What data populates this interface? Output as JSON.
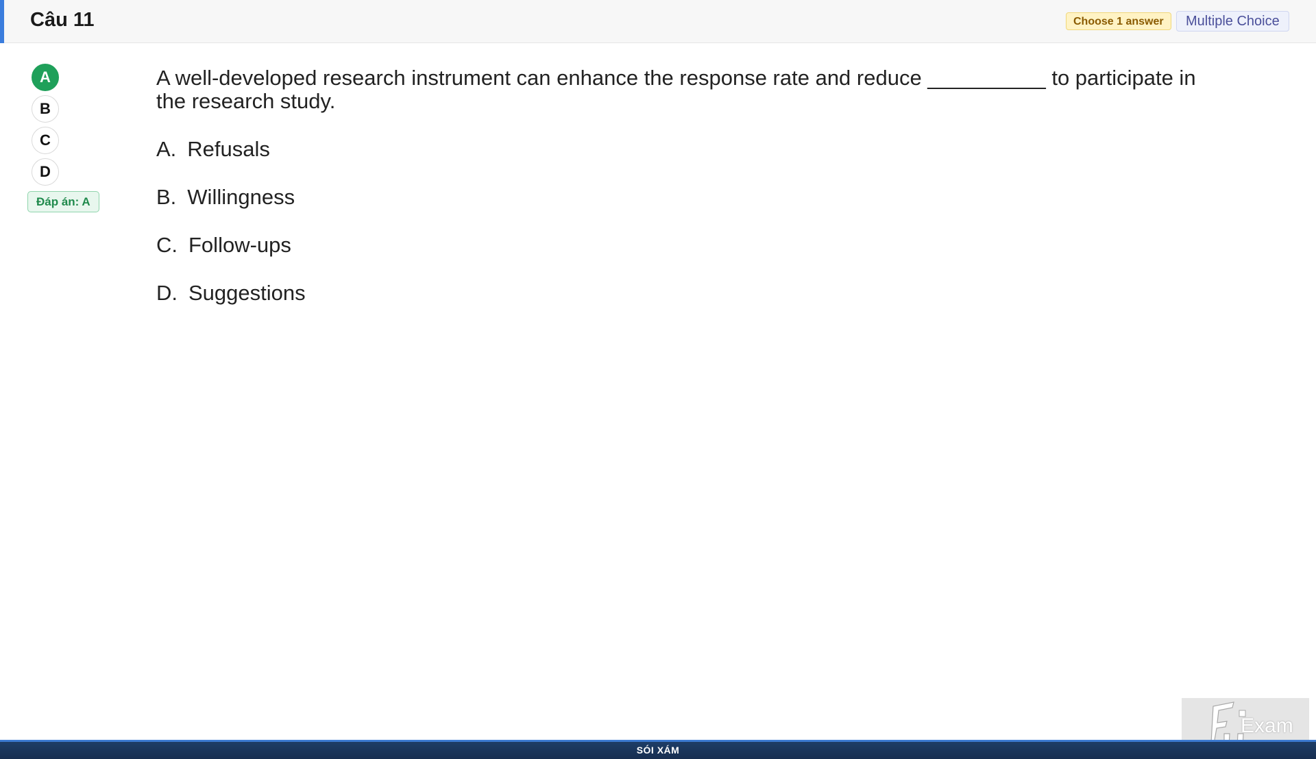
{
  "header": {
    "title": "Câu 11",
    "choose_badge": "Choose 1 answer",
    "type_badge": "Multiple Choice",
    "accent_color": "#3b7ddd"
  },
  "selector": {
    "options": [
      {
        "letter": "A",
        "selected": true
      },
      {
        "letter": "B",
        "selected": false
      },
      {
        "letter": "C",
        "selected": false
      },
      {
        "letter": "D",
        "selected": false
      }
    ],
    "answer_label": "Đáp án: A",
    "selected_color": "#1fa05a"
  },
  "question": {
    "text": "A well-developed research instrument can enhance the response rate and reduce __________ to participate in the research study.",
    "options": [
      {
        "letter": "A.",
        "text": "Refusals"
      },
      {
        "letter": "B.",
        "text": "Willingness"
      },
      {
        "letter": "C.",
        "text": "Follow-ups"
      },
      {
        "letter": "D.",
        "text": "Suggestions"
      }
    ]
  },
  "footer": {
    "text": "SÓI XÁM",
    "color": "#1e3d66"
  },
  "logo": {
    "text": "Exam",
    "icon": "fu-logo-icon"
  }
}
